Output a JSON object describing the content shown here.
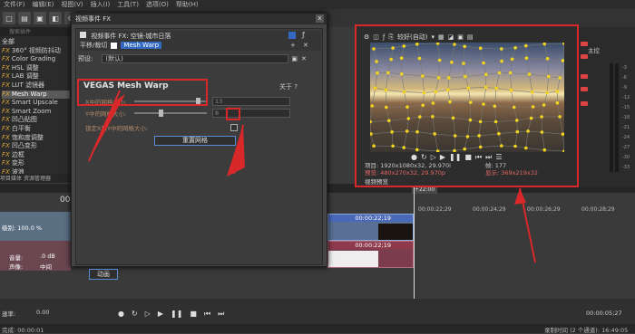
{
  "app": {
    "menubar": [
      "文件(F)",
      "编辑(E)",
      "视图(V)",
      "插入(I)",
      "工具(T)",
      "选项(O)",
      "帮助(H)"
    ],
    "toolbar_icons": [
      "new-icon",
      "open-icon",
      "save-icon",
      "render-icon",
      "properties-icon",
      "undo-icon",
      "redo-icon"
    ]
  },
  "left_pane": {
    "search_placeholder": "搜索插件",
    "items": [
      {
        "label": "全部",
        "fx": false
      },
      {
        "label": "360° 视频防抖动",
        "fx": true
      },
      {
        "label": "Color Grading",
        "fx": true
      },
      {
        "label": "HSL 调整",
        "fx": true
      },
      {
        "label": "LAB 调整",
        "fx": true
      },
      {
        "label": "LUT 滤镜器",
        "fx": true
      },
      {
        "label": "Mesh Warp",
        "fx": true,
        "selected": true
      },
      {
        "label": "Smart Upscale",
        "fx": true
      },
      {
        "label": "Smart Zoom",
        "fx": true
      },
      {
        "label": "凹凸贴图",
        "fx": true
      },
      {
        "label": "白平衡",
        "fx": true
      },
      {
        "label": "饱和度调整",
        "fx": true
      },
      {
        "label": "凹凸变形",
        "fx": true
      },
      {
        "label": "边框",
        "fx": true
      },
      {
        "label": "变形",
        "fx": true
      },
      {
        "label": "波浪",
        "fx": true
      }
    ],
    "tabs": [
      "项目媒体",
      "资源管理器"
    ]
  },
  "dialog": {
    "title": "视频事件 FX",
    "chain_title": "视频事件 FX: 空镜-城市日落",
    "chain_tabs": [
      "平移/裁切",
      "Mesh Warp"
    ],
    "preset_label": "预设:",
    "preset_value": "(默认)",
    "plugin_title": "VEGAS Mesh Warp",
    "about_label": "关于",
    "params": [
      {
        "label": "X中的网格大小:",
        "value": "13",
        "level": 0.9
      },
      {
        "label": "Y中的网格大小:",
        "value": "8",
        "level": 0.35
      }
    ],
    "lock_label": "锁定X和Y中的网格大小:",
    "reset_label": "重置网格",
    "anim_label": "动画",
    "close_glyph": "x"
  },
  "preview": {
    "quality": "较好(自动)",
    "info_left": [
      "项目: 1920x1080x32, 29.970i",
      "预览: 480x270x32, 29.970p",
      "视频预览"
    ],
    "info_right": [
      "帧:   177",
      "显示: 369x219x32"
    ],
    "tab": "视频预览"
  },
  "mixer": {
    "label": "主控",
    "scale": [
      "-3",
      "-6",
      "-9",
      "-12",
      "-15",
      "-18",
      "-21",
      "-24",
      "-27",
      "-30",
      "-33"
    ]
  },
  "timeline": {
    "time_big": "00:00",
    "track1_name": "级别: 100.0 %",
    "track2_vol": "音量:",
    "track2_vol_val": ".0 dB",
    "track2_pan": "声像:",
    "track2_pan_val": "中间",
    "clip_time1": "00:00:22;19",
    "clip_time2": "00:00:22;19",
    "marker": "+22:00",
    "ruler": [
      "00:00:22;29",
      "00:00:24;29",
      "00:00:26;29",
      "00:00:28;29"
    ],
    "counter": "00:00:05;27",
    "zoom_label": "速率:",
    "zoom_val": "0.00"
  },
  "status": {
    "left": "完成: 00:00:01",
    "right": "录制时间 (2 个通道): 16:49:05"
  }
}
